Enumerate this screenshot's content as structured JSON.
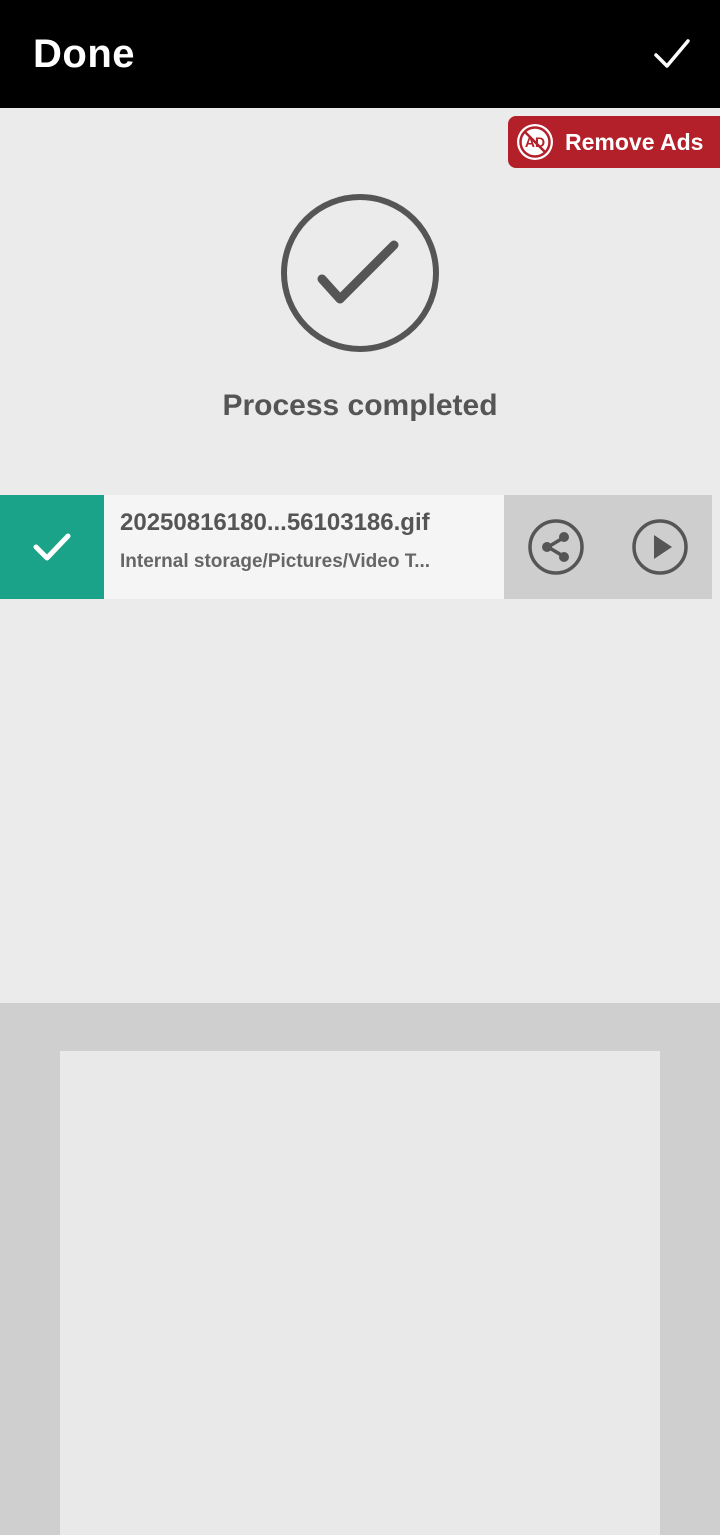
{
  "header": {
    "title": "Done",
    "confirm_icon": "checkmark-icon"
  },
  "promo": {
    "remove_ads_label": "Remove Ads",
    "ad_icon_text": "AD",
    "color": "#b3202a"
  },
  "status": {
    "icon": "check-circle-icon",
    "text": "Process completed"
  },
  "file": {
    "name": "20250816180...56103186.gif",
    "path": "Internal storage/Pictures/Video T...",
    "selected": true,
    "accent_color": "#1ba38a",
    "actions": [
      "share-icon",
      "play-icon"
    ]
  }
}
